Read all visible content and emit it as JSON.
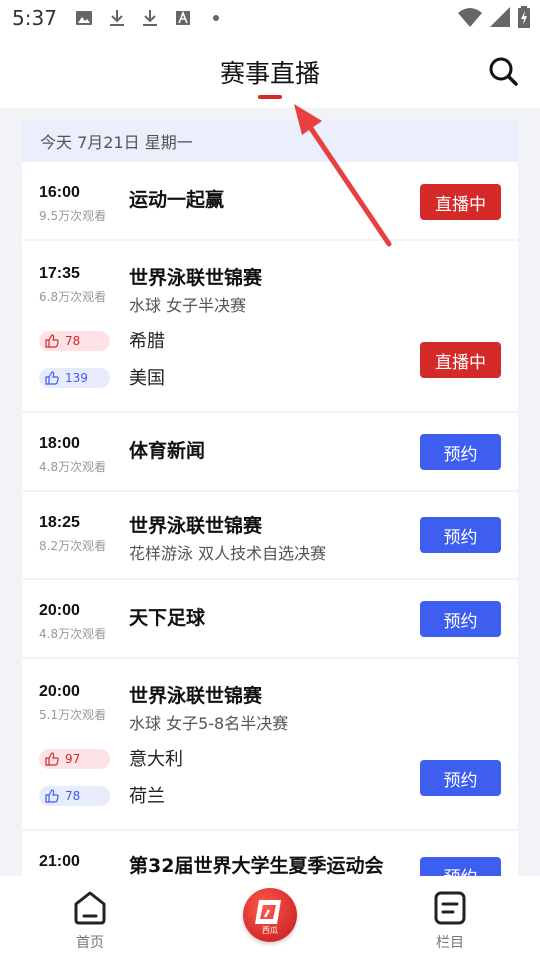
{
  "status_bar": {
    "time": "5:37"
  },
  "header": {
    "title": "赛事直播"
  },
  "date_label": "今天  7月21日 星期一",
  "items": [
    {
      "time": "16:00",
      "views": "9.5万次观看",
      "title": "运动一起赢",
      "button": "直播中"
    },
    {
      "time": "17:35",
      "views": "6.8万次观看",
      "title": "世界泳联世锦赛",
      "subtitle": "水球 女子半决赛",
      "teams": [
        {
          "likes": "78",
          "name": "希腊"
        },
        {
          "likes": "139",
          "name": "美国"
        }
      ],
      "button": "直播中"
    },
    {
      "time": "18:00",
      "views": "4.8万次观看",
      "title": "体育新闻",
      "button": "预约"
    },
    {
      "time": "18:25",
      "views": "8.2万次观看",
      "title": "世界泳联世锦赛",
      "subtitle": "花样游泳 双人技术自选决赛",
      "button": "预约"
    },
    {
      "time": "20:00",
      "views": "4.8万次观看",
      "title": "天下足球",
      "button": "预约"
    },
    {
      "time": "20:00",
      "views": "5.1万次观看",
      "title": "世界泳联世锦赛",
      "subtitle": "水球 女子5-8名半决赛",
      "teams": [
        {
          "likes": "97",
          "name": "意大利"
        },
        {
          "likes": "78",
          "name": "荷兰"
        }
      ],
      "button": "预约"
    },
    {
      "time": "21:00",
      "title": "第32届世界大学生夏季运动会",
      "button": "预约"
    }
  ],
  "nav": {
    "home": "首页",
    "center": "西瓜",
    "columns": "栏目"
  },
  "colors": {
    "live": "#d42a2a",
    "book": "#3e5ef0",
    "accent": "#d62b2b"
  }
}
